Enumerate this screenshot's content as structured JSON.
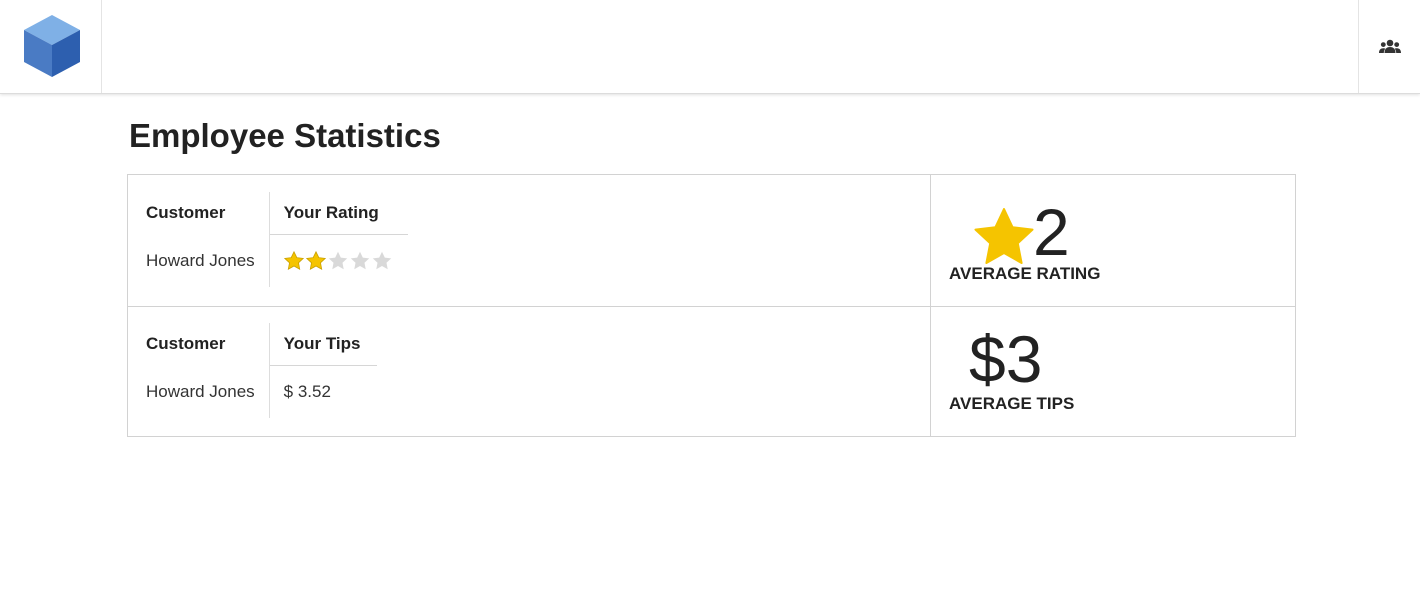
{
  "header": {
    "logo_icon": "blue-cube-icon",
    "users_icon": "users-icon"
  },
  "page": {
    "title": "Employee Statistics"
  },
  "ratings_section": {
    "columns": [
      "Customer",
      "Your Rating"
    ],
    "rows": [
      {
        "customer": "Howard Jones",
        "rating": 2,
        "max_rating": 5
      }
    ],
    "summary_value": "2",
    "summary_label": "AVERAGE RATING",
    "star_color": "#f5c400"
  },
  "tips_section": {
    "columns": [
      "Customer",
      "Your Tips"
    ],
    "rows": [
      {
        "customer": "Howard Jones",
        "tip": "$ 3.52"
      }
    ],
    "summary_value": "$3",
    "summary_label": "AVERAGE TIPS"
  },
  "colors": {
    "accent_blue": "#3f6fbf",
    "star_gold": "#f5c400",
    "star_empty": "#d9d9d9"
  }
}
